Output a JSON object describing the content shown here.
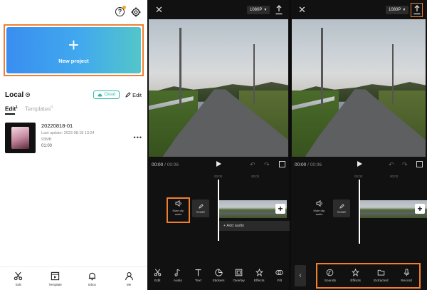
{
  "home": {
    "new_project_label": "New project",
    "local_title": "Local",
    "cloud_label": "Cloud",
    "edit_label": "Edit",
    "tabs": [
      {
        "label": "Edit",
        "count": "1"
      },
      {
        "label": "Templates",
        "count": "0"
      }
    ],
    "project": {
      "name": "20220818-01",
      "last_update": "Last update: 2022.08.18 13:24",
      "size": "93MB",
      "duration": "01:00"
    },
    "nav": [
      {
        "label": "Edit",
        "icon": "scissors-icon"
      },
      {
        "label": "Template",
        "icon": "template-icon"
      },
      {
        "label": "Inbox",
        "icon": "bell-icon"
      },
      {
        "label": "Me",
        "icon": "person-icon"
      }
    ]
  },
  "editor": {
    "resolution": "1080P",
    "current_time": "00:00",
    "total_time": "00:06",
    "ruler_marks": [
      "00:00",
      "00:02"
    ],
    "mute_label": "Mute clip audio",
    "cover_label": "Cover",
    "add_audio_label": "+ Add audio",
    "tools": [
      {
        "label": "Edit",
        "icon": "scissors-icon"
      },
      {
        "label": "Audio",
        "icon": "music-note-icon"
      },
      {
        "label": "Text",
        "icon": "text-icon"
      },
      {
        "label": "Stickers",
        "icon": "sticker-icon"
      },
      {
        "label": "Overlay",
        "icon": "overlay-icon"
      },
      {
        "label": "Effects",
        "icon": "effects-icon"
      },
      {
        "label": "Filt",
        "icon": "filter-icon"
      }
    ],
    "audio_tools": [
      {
        "label": "Sounds",
        "icon": "sounds-icon"
      },
      {
        "label": "Effects",
        "icon": "effects-icon"
      },
      {
        "label": "Extracted",
        "icon": "folder-icon"
      },
      {
        "label": "Record",
        "icon": "mic-icon"
      }
    ]
  },
  "colors": {
    "highlight": "#f08030",
    "cloud": "#2fb9a6",
    "gradient_start": "#3a8ef0",
    "gradient_end": "#53c6c9"
  }
}
